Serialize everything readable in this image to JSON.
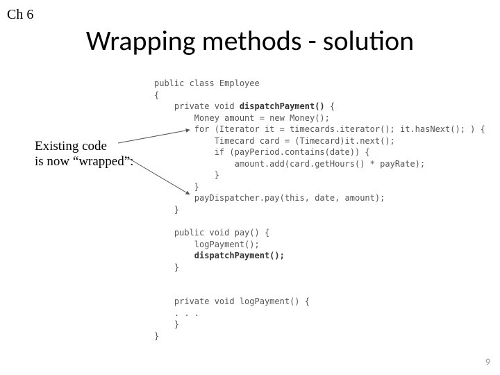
{
  "chapter": "Ch 6",
  "title": "Wrapping methods - solution",
  "annotation_line1": "Existing code",
  "annotation_line2": "is now “wrapped”:",
  "page_number": "9",
  "code": {
    "l01": "public class Employee",
    "l02": "{",
    "l03": "    private void ",
    "l03b": "dispatchPayment()",
    "l03c": " {",
    "l04": "        Money amount = new Money();",
    "l05": "        for (Iterator it = timecards.iterator(); it.hasNext(); ) {",
    "l06": "            Timecard card = (Timecard)it.next();",
    "l07": "            if (payPeriod.contains(date)) {",
    "l08": "                amount.add(card.getHours() * payRate);",
    "l09": "            }",
    "l10": "        }",
    "l11": "        payDispatcher.pay(this, date, amount);",
    "l12": "    }",
    "l13": "",
    "l14": "    public void pay() {",
    "l15": "        logPayment();",
    "l16a": "        ",
    "l16b": "dispatchPayment();",
    "l17": "    }",
    "l18": "",
    "l19": "",
    "l20": "    private void logPayment() {",
    "l21": "    . . .",
    "l22": "    }",
    "l23": "}"
  }
}
